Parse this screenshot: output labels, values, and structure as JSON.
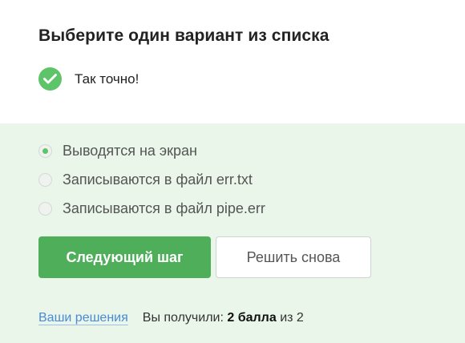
{
  "question": {
    "title": "Выберите один вариант из списка"
  },
  "feedback": {
    "icon": "check-circle-icon",
    "icon_color": "#5ec46a",
    "text": "Так точно!"
  },
  "options": [
    {
      "label": "Выводятся на экран",
      "selected": true
    },
    {
      "label": "Записываются в файл err.txt",
      "selected": false
    },
    {
      "label": "Записываются в файл pipe.err",
      "selected": false
    }
  ],
  "buttons": {
    "next_label": "Следующий шаг",
    "retry_label": "Решить снова"
  },
  "footer": {
    "solutions_link": "Ваши решения",
    "score_prefix": "Вы получили:",
    "score_value": "2 балла",
    "score_suffix": "из 2"
  },
  "colors": {
    "accent_green": "#4fae5a",
    "panel_background": "#e9f6e9",
    "link": "#4a8ad6"
  }
}
